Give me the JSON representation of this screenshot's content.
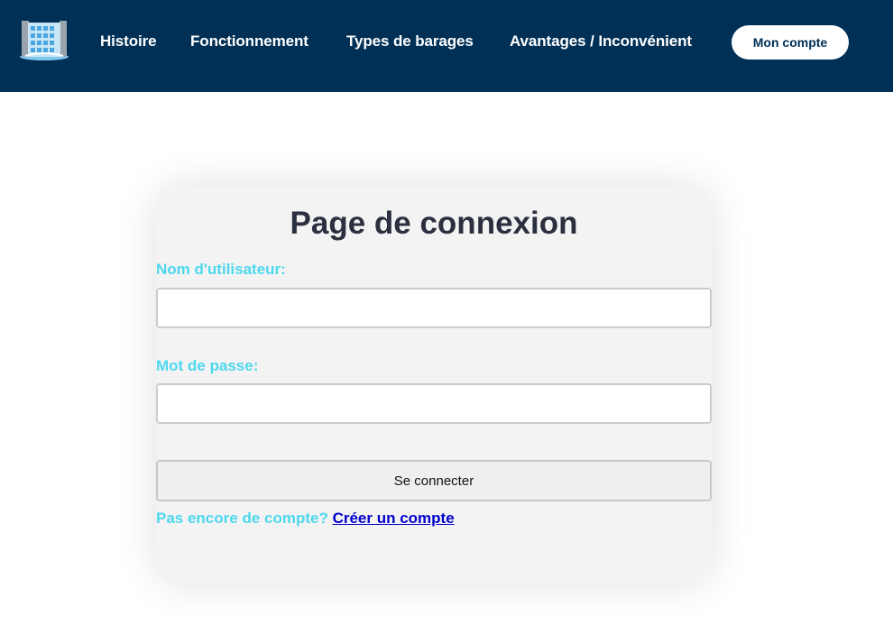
{
  "nav": {
    "logo_icon": "dam-icon",
    "links": [
      "Histoire",
      "Fonctionnement",
      "Types de barages",
      "Avantages / Inconvénient"
    ],
    "account_button": "Mon compte"
  },
  "login": {
    "title": "Page de connexion",
    "username_label": "Nom d'utilisateur:",
    "username_value": "",
    "password_label": "Mot de passe:",
    "password_value": "",
    "submit_label": "Se connecter",
    "signup_prompt": "Pas encore de compte?",
    "signup_link": "Créer un compte"
  },
  "colors": {
    "navbar": "#003056",
    "label_accent": "#4dd8ef",
    "link": "#0000cc",
    "title": "#2b2f3f"
  }
}
